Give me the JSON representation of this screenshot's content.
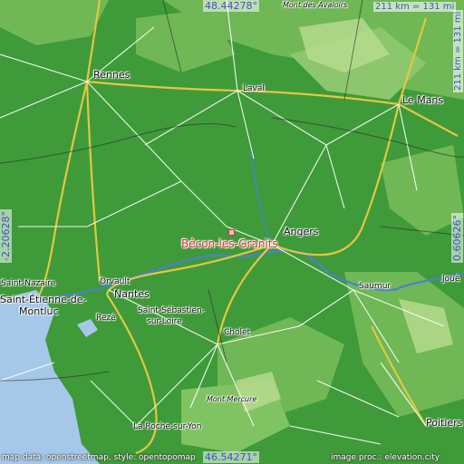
{
  "coords": {
    "top": "48.44278°",
    "bottom": "46.54271°",
    "left": "-2.20628°",
    "right": "0.60626°"
  },
  "scale": {
    "horizontal": "211 km = 131 mi",
    "vertical": "211 km = 131 mi"
  },
  "target": {
    "name": "Bécon-les-Granits",
    "color": "#e03030"
  },
  "cities": {
    "rennes": "Rennes",
    "laval": "Laval",
    "le_mans": "Le Mans",
    "angers": "Angers",
    "saumur": "Saumur",
    "joue": "Joué",
    "saint_nazaire": "Saint-Nazaire",
    "saint_etienne": "Saint-Étienne-de-",
    "montluc": "Montluc",
    "orvault": "Orvault",
    "nantes": "Nantes",
    "reze": "Rezé",
    "saint_sebastien": "Saint-Sébastien-",
    "sur_loire": "sur-Loire",
    "cholet": "Cholet",
    "la_roche": "La Roche-sur-Yon",
    "poitiers": "Poitiers",
    "mont_avaloirs": "Mont des Avaloirs",
    "mont_mercure": "Mont Mercure"
  },
  "credits": {
    "left": "map data: openstreetmap, style: opentopomap",
    "right": "image proc.: elevation.city"
  },
  "colors": {
    "lowland": "#3f9a3a",
    "upland": "#7fc160",
    "sea": "#a5c8e8",
    "river": "#4d7fd1",
    "motorway": "#e0c840",
    "road": "#ffffff"
  }
}
